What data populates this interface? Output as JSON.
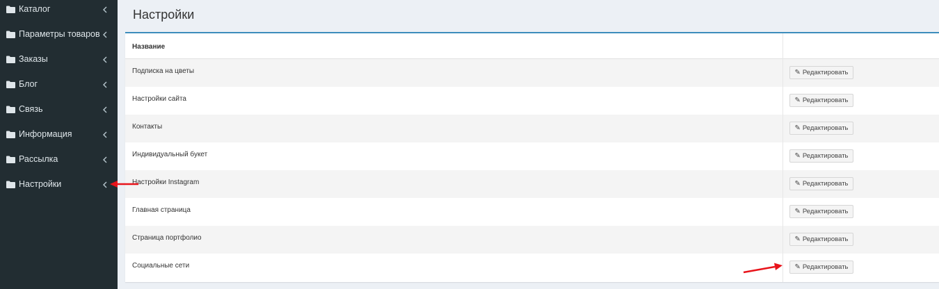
{
  "sidebar": {
    "items": [
      {
        "label": "Каталог"
      },
      {
        "label": "Параметры товаров"
      },
      {
        "label": "Заказы"
      },
      {
        "label": "Блог"
      },
      {
        "label": "Связь"
      },
      {
        "label": "Информация"
      },
      {
        "label": "Рассылка"
      },
      {
        "label": "Настройки"
      }
    ]
  },
  "page": {
    "title": "Настройки"
  },
  "table": {
    "columns": [
      "Название",
      ""
    ],
    "edit_label": "Редактировать",
    "rows": [
      {
        "name": "Подписка на цветы"
      },
      {
        "name": "Настройки сайта"
      },
      {
        "name": "Контакты"
      },
      {
        "name": "Индивидуальный букет"
      },
      {
        "name": "Настройки Instagram"
      },
      {
        "name": "Главная страница"
      },
      {
        "name": "Страница портфолио"
      },
      {
        "name": "Социальные сети"
      }
    ]
  },
  "colors": {
    "sidebar_bg": "#222d32",
    "accent": "#3c8dbc",
    "annotation_arrow": "#e8141b"
  },
  "icons": {
    "nav_item": "folder-icon",
    "nav_expand": "chevron-left-icon",
    "edit": "pencil-icon"
  }
}
